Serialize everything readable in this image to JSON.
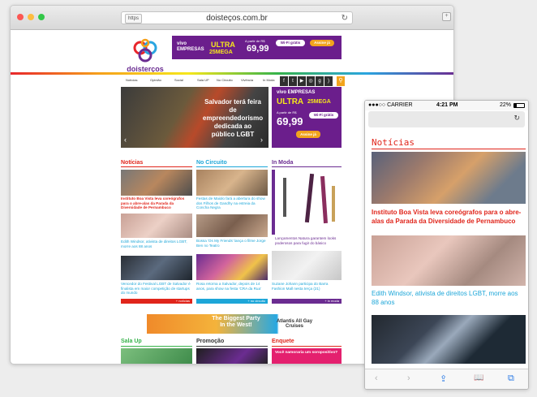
{
  "desktop": {
    "url_protocol": "https",
    "url": "doisteços.com.br",
    "site_name": "doisterços",
    "ad_top": {
      "brand": "vivo EMPRESAS",
      "product": "ULTRA",
      "speed": "25MEGA",
      "price_prefix": "A partir de R$",
      "price": "69,99",
      "wifi": "Wi-Fi grátis",
      "cta": "Assine já"
    },
    "menu": [
      "Notícias",
      "Opinião",
      "Social",
      "Sala UP",
      "No Circuito",
      "Vivência",
      "In Moda"
    ],
    "hero": {
      "title": "Salvador terá feira de empreendedorismo dedicada ao público LGBT",
      "prev": "‹",
      "next": "›"
    },
    "ad_side": {
      "brand": "vivo EMPRESAS",
      "product": "ULTRA",
      "speed": "25MEGA",
      "price_prefix": "A partir de R$",
      "price": "69,99",
      "wifi": "Wi-Fi grátis",
      "cta": "Assine já"
    },
    "columns": {
      "noticias": {
        "title": "Notícias",
        "color": "#e0251b",
        "items": [
          "Instituto Boa Vista leva coreógrafos para o abre-alas da Parada da Diversidade de Pernambuco",
          "Edith Windsor, ativista de direitos LGBT, morre aos 88 anos",
          "Vencedor do Festival LGBT de Salvador é finalista em maior competição de startups do mundo"
        ],
        "more": "+ notícias"
      },
      "circuito": {
        "title": "No Circuito",
        "color": "#1da6d8",
        "items": [
          "Festas de Maiolo fará a abertura do show dos Filhos de Gandhy na estreia da Concha Negra",
          "Bossa 'Os My Friends' lança o filme Jorge Ben no Teatro",
          "Rosa retorna a Salvador, depois de 14 anos, para show na festa 'CRA da Rua'"
        ],
        "more": "+ no circuito"
      },
      "moda": {
        "title": "In Moda",
        "color": "#6b2c91",
        "items": [
          "Lançamentos Natura garantem looks poderosos para fugir do básico",
          "Suzane Johann participa do Barra Fashion Mall nesta terça (21)"
        ],
        "more": "+ in moda"
      }
    },
    "ad_mid": {
      "text": "The Biggest Party In the West!",
      "brand": "Atlantis All Gay Cruises"
    },
    "bottom": {
      "sala_up": "Sala Up",
      "promocao": "Promoção",
      "enquete": "Enquete",
      "enquete_q": "Você namoraria um soropositivo?"
    }
  },
  "mobile": {
    "carrier": "●●●○○ CARRIER",
    "time": "4:21 PM",
    "battery": "22%",
    "section": "Notícias",
    "news": [
      "Instituto Boa Vista leva coreógrafos para o abre-alas da Parada da Diversidade de Pernambuco",
      "Edith Windsor, ativista de direitos LGBT, morre aos 88 anos"
    ],
    "toolbar": [
      "‹",
      "›",
      "⇪",
      "📖",
      "⧉"
    ]
  },
  "colors": {
    "brand_purple": "#6b2c91",
    "red": "#e0251b",
    "cyan": "#1da6d8",
    "orange": "#f2a41d"
  }
}
